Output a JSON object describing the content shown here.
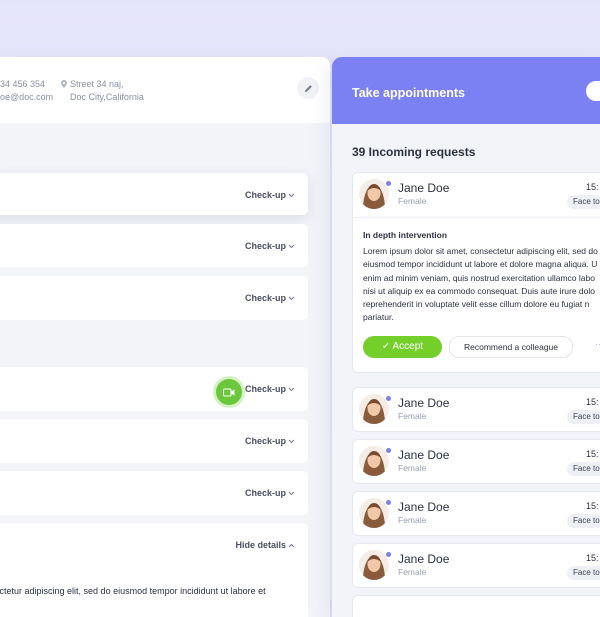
{
  "left": {
    "phone": "34 456 354",
    "email": "oe@doc.com",
    "address_line1": "Street 34 naj,",
    "address_line2": "Doc City,California",
    "rows": [
      {
        "label": "Check-up"
      },
      {
        "label": "Check-up"
      },
      {
        "label": "Check-up"
      },
      {
        "label": "Check-up"
      },
      {
        "label": "Check-up"
      },
      {
        "label": "Check-up"
      },
      {
        "label": "Hide details"
      }
    ],
    "detail_text": "sectetur adipiscing elit, sed do eiusmod tempor incididunt ut labore et"
  },
  "right": {
    "header_title": "Take appointments",
    "incoming": "39 Incoming requests",
    "expanded": {
      "name": "Jane Doe",
      "gender": "Female",
      "time": "15:",
      "chip": "Face to",
      "intervention": "In depth intervention",
      "body": "Lorem ipsum dolor sit amet, consectetur adipiscing elit, sed do\neiusmod tempor incididunt ut labore et dolore magna aliqua. U\nenim ad minim veniam, quis nostrud exercitation ullamco labo\nnisi ut aliquip ex ea commodo consequat. Duis aute irure dolo\nreprehenderit in voluptate velit esse cillum dolore eu fugiat n\npariatur.",
      "accept": "✓ Accept",
      "recommend": "Recommend a colleague"
    },
    "cards": [
      {
        "name": "Jane Doe",
        "gender": "Female",
        "time": "15:",
        "chip": "Face to"
      },
      {
        "name": "Jane Doe",
        "gender": "Female",
        "time": "15:",
        "chip": "Face to"
      },
      {
        "name": "Jane Doe",
        "gender": "Female",
        "time": "15:",
        "chip": "Face to"
      },
      {
        "name": "Jane Doe",
        "gender": "Female",
        "time": "15:",
        "chip": "Face to"
      }
    ]
  },
  "colors": {
    "accent": "#7b80f2",
    "accept": "#74cf2b",
    "video": "#6bc83a"
  },
  "icons": [
    "location-pin-icon",
    "pencil-icon",
    "chevron-down-icon",
    "chevron-up-icon",
    "video-camera-icon",
    "check-icon",
    "more-dots-icon"
  ]
}
